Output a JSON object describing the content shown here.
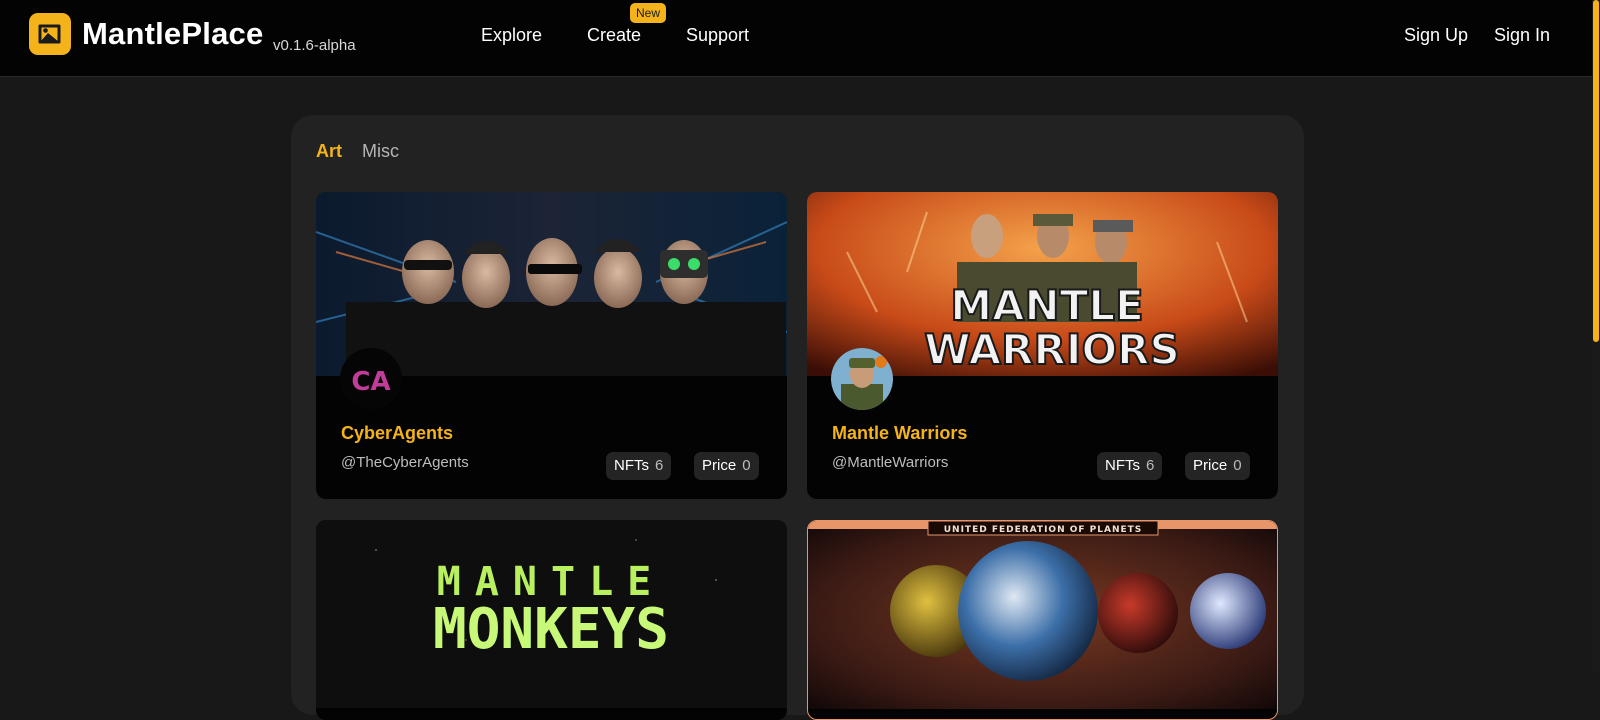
{
  "header": {
    "brand": "MantlePlace",
    "version": "v0.1.6-alpha",
    "nav": [
      {
        "label": "Explore"
      },
      {
        "label": "Create",
        "badge": "New"
      },
      {
        "label": "Support"
      }
    ],
    "auth": {
      "sign_up": "Sign Up",
      "sign_in": "Sign In"
    },
    "logo_icon": "image-icon",
    "accent": "#f5b31b"
  },
  "tabs": [
    {
      "label": "Art",
      "active": true
    },
    {
      "label": "Misc",
      "active": false
    }
  ],
  "collections": [
    {
      "name": "CyberAgents",
      "handle": "@TheCyberAgents",
      "nfts_label": "NFTs",
      "nfts": "6",
      "price_label": "Price",
      "price": "0",
      "avatar_text": "CA"
    },
    {
      "name": "Mantle Warriors",
      "handle": "@MantleWarriors",
      "nfts_label": "NFTs",
      "nfts": "6",
      "price_label": "Price",
      "price": "0",
      "banner_text": [
        "MANTLE",
        "WARRIORS"
      ]
    },
    {
      "banner_text": [
        "MANTLE",
        "MONKEYS"
      ]
    },
    {
      "banner_text": [
        "UNITED FEDERATION OF PLANETS"
      ]
    }
  ]
}
